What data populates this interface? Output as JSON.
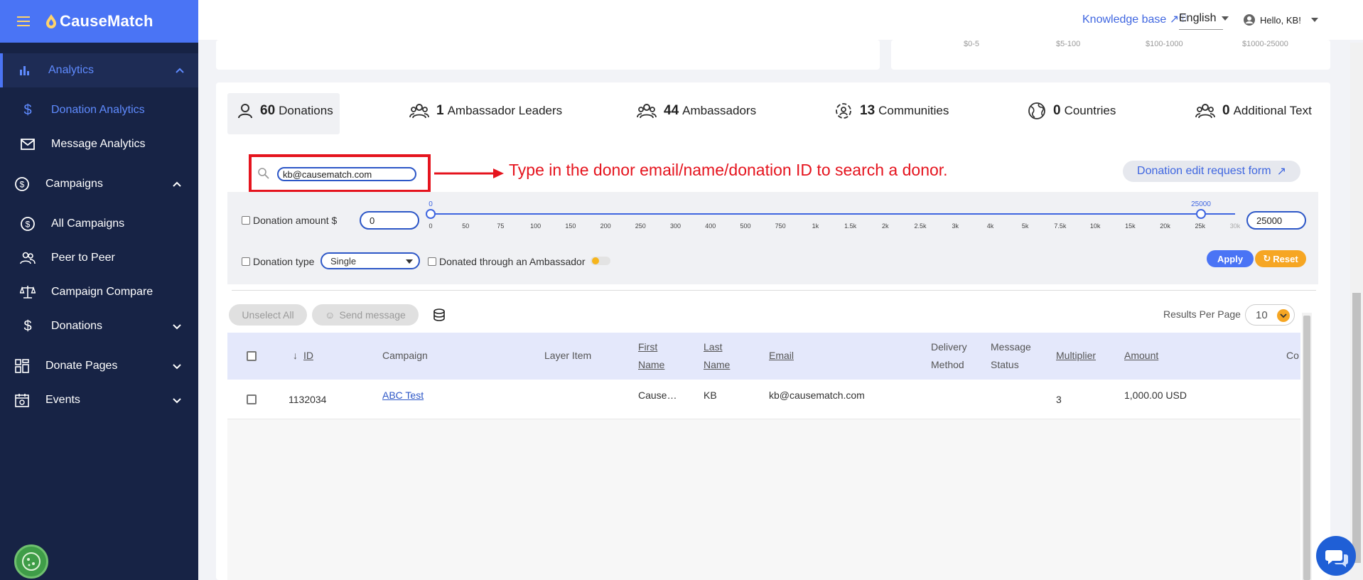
{
  "app": {
    "brand": "CauseMatch",
    "colors": {
      "sidebar": "#172345",
      "brand_bar": "#4a74f5",
      "accent": "#3f66e0",
      "annotation": "#e5141e",
      "orange": "#f6a623"
    }
  },
  "header": {
    "knowledge_base": "Knowledge base",
    "language": "English",
    "greeting": "Hello, KB!"
  },
  "sidebar": {
    "items": [
      {
        "label": "Analytics",
        "icon": "bar-chart-icon"
      },
      {
        "label": "Donation Analytics",
        "icon": "dollar-icon"
      },
      {
        "label": "Message Analytics",
        "icon": "mail-icon"
      },
      {
        "label": "Campaigns",
        "icon": "dollar-circle-icon"
      },
      {
        "label": "All Campaigns",
        "icon": "dollar-circle-icon"
      },
      {
        "label": "Peer to Peer",
        "icon": "people-icon"
      },
      {
        "label": "Campaign Compare",
        "icon": "scale-icon"
      },
      {
        "label": "Donations",
        "icon": "dollar-icon"
      },
      {
        "label": "Donate Pages",
        "icon": "grid-icon"
      },
      {
        "label": "Events",
        "icon": "calendar-icon"
      }
    ]
  },
  "top_chart": {
    "range_labels": [
      "$0-5",
      "$5-100",
      "$100-1000",
      "$1000-25000"
    ]
  },
  "stats": [
    {
      "value": "60",
      "label": "Donations",
      "icon": "person-icon"
    },
    {
      "value": "1",
      "label": "Ambassador Leaders",
      "icon": "group-icon"
    },
    {
      "value": "44",
      "label": "Ambassadors",
      "icon": "group-icon"
    },
    {
      "value": "13",
      "label": "Communities",
      "icon": "community-icon"
    },
    {
      "value": "0",
      "label": "Countries",
      "icon": "globe-icon"
    },
    {
      "value": "0",
      "label": "Additional Text",
      "icon": "group-icon"
    }
  ],
  "search": {
    "value": "kb@causematch.com",
    "annotation": "Type in the donor email/name/donation ID to search a donor."
  },
  "edit_request_button": "Donation edit request form",
  "filters": {
    "amount_label": "Donation amount $",
    "amount_min": "0",
    "amount_max": "25000",
    "slider_low_value": "0",
    "slider_high_value": "25000",
    "ticks": [
      "0",
      "50",
      "75",
      "100",
      "150",
      "200",
      "250",
      "300",
      "400",
      "500",
      "750",
      "1k",
      "1.5k",
      "2k",
      "2.5k",
      "3k",
      "4k",
      "5k",
      "7.5k",
      "10k",
      "15k",
      "20k",
      "25k",
      "30k"
    ],
    "type_label": "Donation type",
    "type_value": "Single",
    "ambassador_label": "Donated through an Ambassador",
    "apply": "Apply",
    "reset": "Reset"
  },
  "toolbar": {
    "unselect_all": "Unselect All",
    "send_message": "Send message",
    "results_per_page_label": "Results Per Page",
    "results_per_page": "10"
  },
  "table": {
    "headers": {
      "id": "ID",
      "campaign": "Campaign",
      "layer_item": "Layer Item",
      "first_name_1": "First",
      "first_name_2": "Name",
      "last_name_1": "Last",
      "last_name_2": "Name",
      "email": "Email",
      "delivery_1": "Delivery",
      "delivery_2": "Method",
      "message_1": "Message",
      "message_2": "Status",
      "multiplier": "Multiplier",
      "amount": "Amount",
      "more": "Co"
    },
    "rows": [
      {
        "id": "1132034",
        "campaign": "ABC Test",
        "first_name": "Cause…",
        "last_name": "KB",
        "email": "kb@causematch.com",
        "multiplier": "3",
        "amount": "1,000.00 USD"
      }
    ]
  }
}
